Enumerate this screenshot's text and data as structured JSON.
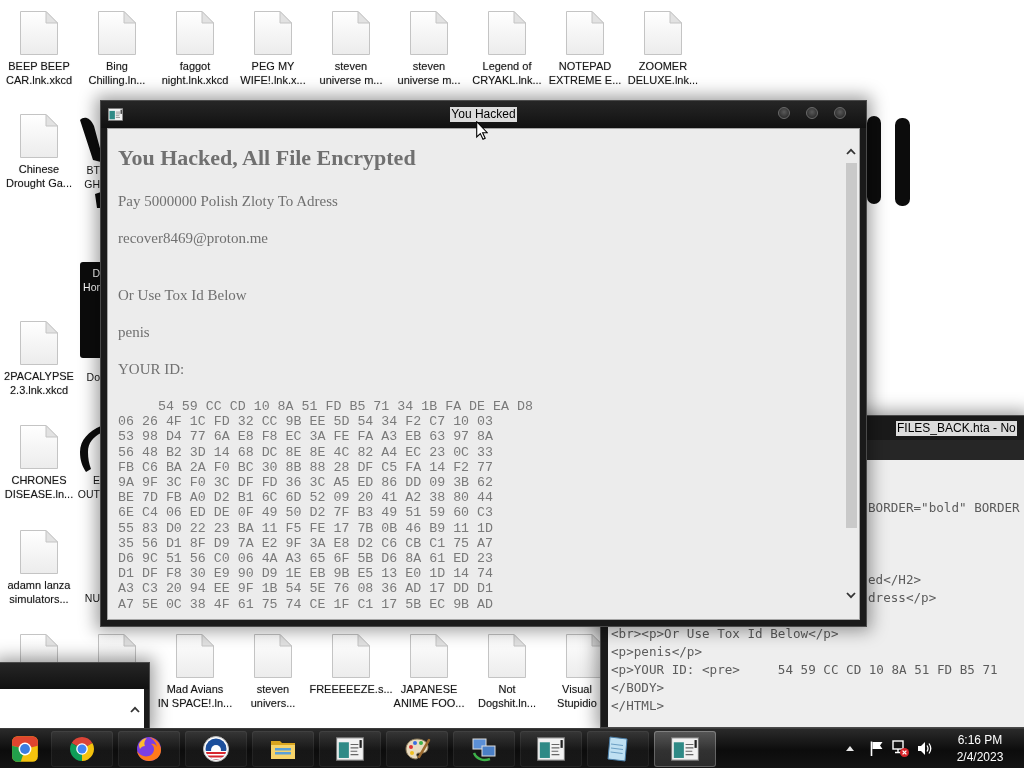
{
  "desktop": {
    "top_row_icons": [
      {
        "kind": "file",
        "label": "BEEP BEEP\nCAR.lnk.xkcd"
      },
      {
        "kind": "file",
        "label": "Bing\nChilling.ln..."
      },
      {
        "kind": "file",
        "label": "faggot\nnight.lnk.xkcd"
      },
      {
        "kind": "file",
        "label": "PEG MY\nWIFE!.lnk.x..."
      },
      {
        "kind": "file",
        "label": "steven\nuniverse m..."
      },
      {
        "kind": "file",
        "label": "steven\nuniverse m..."
      },
      {
        "kind": "file",
        "label": "Legend of\nCRYAKL.lnk..."
      },
      {
        "kind": "file",
        "label": "NOTEPAD\nEXTREME E..."
      },
      {
        "kind": "file",
        "label": "ZOOMER\nDELUXE.lnk..."
      }
    ],
    "left_column_icons": [
      {
        "kind": "file",
        "label": "Chinese\nDrought Ga..."
      },
      {
        "kind": "file",
        "label": "2PACALYPSE\n2.3.lnk.xkcd"
      },
      {
        "kind": "file",
        "label": "CHRONES\nDISEASE.ln..."
      },
      {
        "kind": "file",
        "label": "adamn lanza\nsimulators..."
      }
    ],
    "icons_behind_window_left": [
      {
        "kind": "image",
        "label": "BT\nGH"
      },
      {
        "kind": "image",
        "label": "D\nHor"
      },
      {
        "kind": "file",
        "label": "Do"
      },
      {
        "kind": "image",
        "label": "E\nOUT"
      },
      {
        "kind": "file",
        "label": "NU"
      }
    ],
    "icons_behind_window_right": [
      {
        "kind": "image"
      }
    ],
    "bottom_row_icons": [
      {
        "kind": "file"
      },
      {
        "kind": "file"
      },
      {
        "kind": "file",
        "label": "Mad Avians\nIN SPACE!.ln..."
      },
      {
        "kind": "file",
        "label": "steven\nunivers..."
      },
      {
        "kind": "file",
        "label": "FREEEEEZE.s..."
      },
      {
        "kind": "file",
        "label": "JAPANESE\nANIME FOO..."
      },
      {
        "kind": "file",
        "label": "Not\nDogshit.ln..."
      },
      {
        "kind": "file",
        "label": "Visual\nStupidio"
      }
    ]
  },
  "notepad_window": {
    "title": "FILES_BACK.hta - No",
    "lines": [
      {
        "kind": "right_part",
        "text": "BORDER=\"bold\" BORDER"
      },
      {
        "kind": "right_part",
        "text": "ed</H2>"
      },
      {
        "kind": "right_part",
        "text": "dress</p>"
      },
      {
        "kind": "whole",
        "text": "<br><p>Or Use Tox Id Below</p>"
      },
      {
        "kind": "whole",
        "text": "<p>penis</p>"
      },
      {
        "kind": "whole",
        "text": "<p>YOUR ID: <pre>     54 59 CC CD 10 8A 51 FD B5 71"
      },
      {
        "kind": "whole",
        "text": "</BODY>"
      },
      {
        "kind": "whole",
        "text": "</HTML>"
      }
    ]
  },
  "main_window": {
    "title": "You Hacked",
    "heading": "You Hacked, All File Encrypted",
    "paragraphs": [
      "Pay 5000000 Polish Zloty To Adress",
      "recover8469@proton.me",
      "Or Use Tox Id Below",
      "penis",
      "YOUR ID:"
    ],
    "id_lines": [
      "     54 59 CC CD 10 8A 51 FD B5 71 34 1B FA DE EA D8",
      "06 26 4F 1C FD 32 CC 9B EE 5D 54 34 F2 C7 10 03",
      "53 98 D4 77 6A E8 F8 EC 3A FE FA A3 EB 63 97 8A",
      "56 48 B2 3D 14 68 DC 8E 8E 4C 82 A4 EC 23 0C 33",
      "FB C6 BA 2A F0 BC 30 8B 88 28 DF C5 FA 14 F2 77",
      "9A 9F 3C F0 3C DF FD 36 3C A5 ED 86 DD 09 3B 62",
      "BE 7D FB A0 D2 B1 6C 6D 52 09 20 41 A2 38 80 44",
      "6E C4 06 ED DE 0F 49 50 D2 7F B3 49 51 59 60 C3",
      "55 83 D0 22 23 BA 11 F5 FE 17 7B 0B 46 B9 11 1D",
      "35 56 D1 8F D9 7A E2 9F 3A E8 D2 C6 CB C1 75 A7",
      "D6 9C 51 56 C0 06 4A A3 65 6F 5B D6 8A 61 ED 23",
      "D1 DF F8 30 E9 90 D9 1E EB 9B E5 13 E0 1D 14 74",
      "A3 C3 20 94 EE 9F 1B 54 5E 76 08 36 AD 17 DD D1",
      "A7 5E 0C 38 4F 61 75 74 CE 1F C1 17 5B EC 9B AD"
    ]
  },
  "taskbar": {
    "items": [
      {
        "kind": "start",
        "selected": false
      },
      {
        "kind": "ring_logo",
        "selected": false
      },
      {
        "kind": "flame_globe",
        "selected": false
      },
      {
        "kind": "round_logo",
        "selected": false
      },
      {
        "kind": "folder",
        "selected": false
      },
      {
        "kind": "window",
        "selected": false
      },
      {
        "kind": "palette",
        "selected": false
      },
      {
        "kind": "computers",
        "selected": false
      },
      {
        "kind": "window",
        "selected": false
      },
      {
        "kind": "notepad",
        "selected": false
      },
      {
        "kind": "window",
        "selected": true
      }
    ],
    "tray": {
      "network_connected": false,
      "time": "6:16 PM",
      "date": "2/4/2023"
    }
  }
}
